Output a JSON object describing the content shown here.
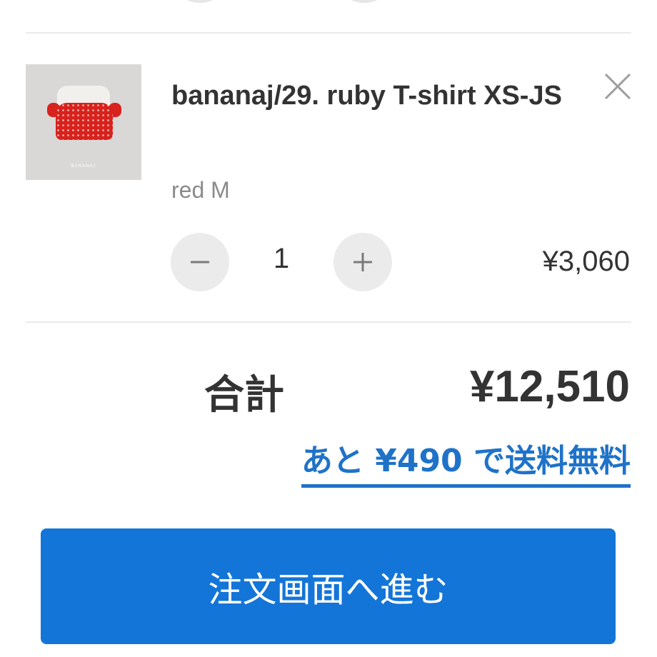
{
  "cart_item": {
    "name": "bananaj/29. ruby T-shirt XS-JS",
    "variant": "red M",
    "quantity": "1",
    "price": "¥3,060",
    "thumbnail_brand": "BANANAJ"
  },
  "summary": {
    "total_label": "合計",
    "total_value": "¥12,510",
    "free_shipping_note": "あと ¥490 で送料無料"
  },
  "checkout": {
    "button_label": "注文画面へ進む"
  },
  "colors": {
    "accent": "#1f72c8",
    "button": "#1375d8",
    "text": "#333333",
    "muted": "#8a8a8a"
  },
  "icons": [
    "close-icon",
    "minus-icon",
    "plus-icon"
  ]
}
